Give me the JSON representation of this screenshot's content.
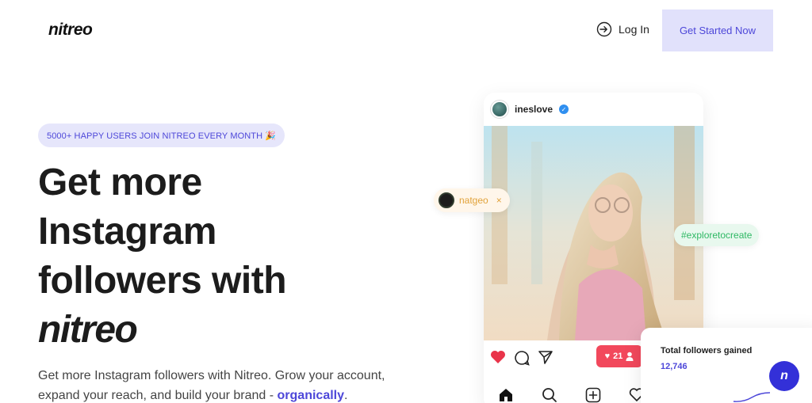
{
  "header": {
    "logo": "nitreo",
    "login_label": "Log In",
    "cta_label": "Get Started Now"
  },
  "hero": {
    "badge": "5000+ HAPPY USERS JOIN NITREO EVERY MONTH 🎉",
    "headline_line1": "Get more",
    "headline_line2": "Instagram",
    "headline_line3": "followers with",
    "headline_brand": "nitreo",
    "sub_text": "Get more Instagram followers with Nitreo. Grow your account, expand your reach, and build your brand - ",
    "sub_highlight": "organically",
    "sub_end": "."
  },
  "post": {
    "username": "ineslove",
    "like_count": "21",
    "tag_left": "natgeo",
    "tag_left_close": "×",
    "tag_right": "#exploretocreate"
  },
  "stats": {
    "label": "Total followers gained",
    "value": "12,746",
    "button_letter": "n"
  },
  "colors": {
    "accent": "#4d47d9",
    "accent_bg": "#e1e1fb",
    "like_red": "#f2485c",
    "natgeo_orange": "#e1a23a",
    "explore_green": "#2eb864"
  },
  "icons": [
    "log-in-icon",
    "verified-icon",
    "heart-icon",
    "comment-icon",
    "send-icon",
    "home-icon",
    "search-icon",
    "add-icon",
    "person-icon"
  ]
}
